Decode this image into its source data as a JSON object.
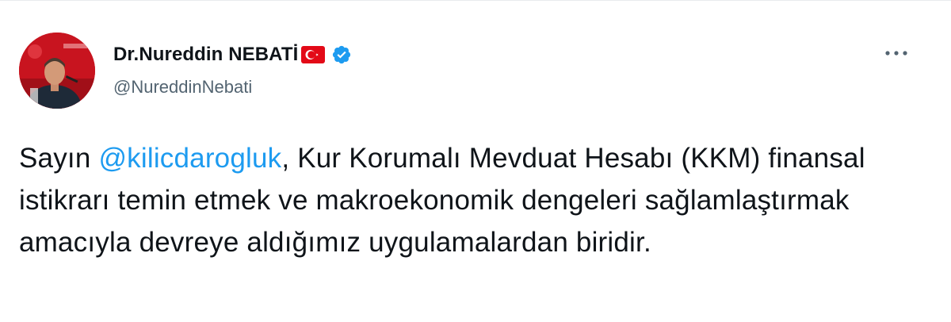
{
  "author": {
    "display_name": "Dr.Nureddin NEBATİ",
    "handle": "@NureddinNebati",
    "flag_icon": "turkey-flag-icon",
    "verified_icon": "verified-badge-icon"
  },
  "tweet": {
    "text_before": "Sayın ",
    "mention": "@kilicdarogluk",
    "text_after": ", Kur Korumalı Mevduat Hesabı (KKM) finansal istikrarı temin etmek ve makroekonomik dengeleri sağlamlaştırmak amacıyla devreye aldığımız uygulamalardan biridir."
  },
  "actions": {
    "more_icon": "more-horizontal-icon"
  },
  "colors": {
    "accent": "#1d9bf0",
    "secondary_text": "#536471",
    "primary_text": "#0f1419",
    "flag_red": "#e30a17"
  }
}
